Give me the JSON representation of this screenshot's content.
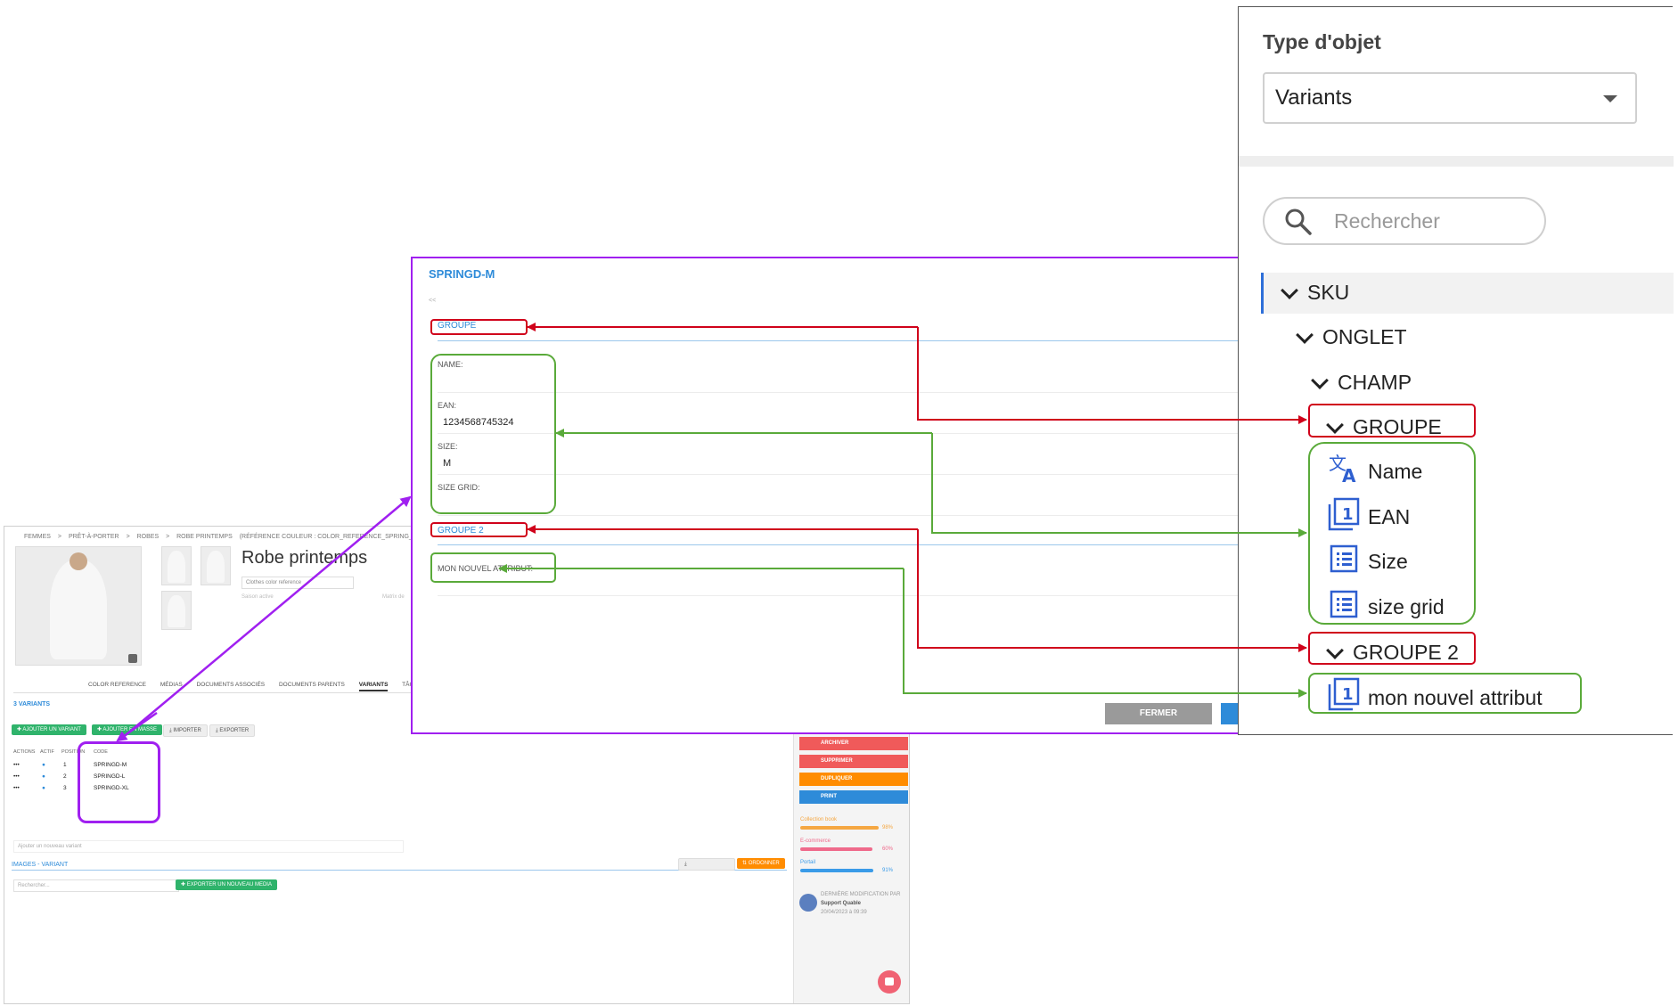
{
  "product_page": {
    "breadcrumb": [
      "FEMMES",
      ">",
      "PRÊT-À-PORTER",
      ">",
      "ROBES",
      ">",
      "ROBE PRINTEMPS",
      "(RÉFÉRENCE COULEUR : COLOR_REFERENCE_SPRING_DRESS)"
    ],
    "title": "Robe printemps",
    "color_select": "Clothes color reference",
    "placeholder_season": "Saison active",
    "placeholder_matrix": "Matrix de",
    "tabs": [
      "COLOR REFERENCE",
      "MÉDIAS",
      "DOCUMENTS ASSOCIÉS",
      "DOCUMENTS PARENTS",
      "VARIANTS",
      "TÂCHES"
    ],
    "variants_count": "3 VARIANTS",
    "buttons": {
      "add_variant": "AJOUTER UN VARIANT",
      "add_bulk": "AJOUTER EN MASSE",
      "import": "IMPORTER",
      "export": "EXPORTER"
    },
    "table_headers": [
      "ACTIONS",
      "ACTIF",
      "POSITION",
      "CODE"
    ],
    "rows": [
      {
        "actions": "•••",
        "position": "1",
        "code": "SPRINGD-M"
      },
      {
        "actions": "•••",
        "position": "2",
        "code": "SPRINGD-L"
      },
      {
        "actions": "•••",
        "position": "3",
        "code": "SPRINGD-XL"
      }
    ],
    "add_variant_placeholder": "Ajouter un nouveau variant",
    "images_section": "IMAGES - VARIANT",
    "images_search": "Rechercher...",
    "export_media": "EXPORTER UN NOUVEAU MEDIA",
    "order_button": "ORDONNER",
    "side_actions": [
      "ARCHIVER",
      "SUPPRIMER",
      "DUPLIQUER",
      "PRINT"
    ],
    "progress": [
      {
        "label": "Collection book",
        "percent": "98%",
        "value": 0.98,
        "color": "#f5a742"
      },
      {
        "label": "E-commerce",
        "percent": "60%",
        "value": 0.9,
        "color": "#ef6a8b"
      },
      {
        "label": "Portail",
        "percent": "91%",
        "value": 0.91,
        "color": "#3a9be8"
      }
    ],
    "last_modified_label": "DERNIÈRE MODIFICATION PAR",
    "last_modified_user": "Support Quable",
    "last_modified_date": "20/04/2023 à 09:39"
  },
  "modal": {
    "title": "SPRINGD-M",
    "back": "<<",
    "group1": "GROUPE",
    "fields": [
      {
        "label": "NAME:",
        "value": ""
      },
      {
        "label": "EAN:",
        "value": "1234568745324"
      },
      {
        "label": "SIZE:",
        "value": "M"
      },
      {
        "label": "SIZE GRID:",
        "value": ""
      }
    ],
    "group2": "GROUPE 2",
    "new_attr_label": "MON NOUVEL ATTRIBUT:",
    "close_button": "FERMER"
  },
  "type_panel": {
    "title": "Type d'objet",
    "selected": "Variants",
    "search_placeholder": "Rechercher",
    "tree": {
      "sku": "SKU",
      "onglet": "ONGLET",
      "champ": "CHAMP",
      "groupe": "GROUPE",
      "attrs": [
        "Name",
        "EAN",
        "Size",
        "size grid"
      ],
      "groupe2": "GROUPE 2",
      "groupe2_attrs": [
        "mon nouvel attribut"
      ]
    }
  },
  "colors": {
    "red": "#d0021b",
    "green": "#5aaa3a",
    "purple": "#a020f0",
    "blue": "#2e8bd9"
  }
}
